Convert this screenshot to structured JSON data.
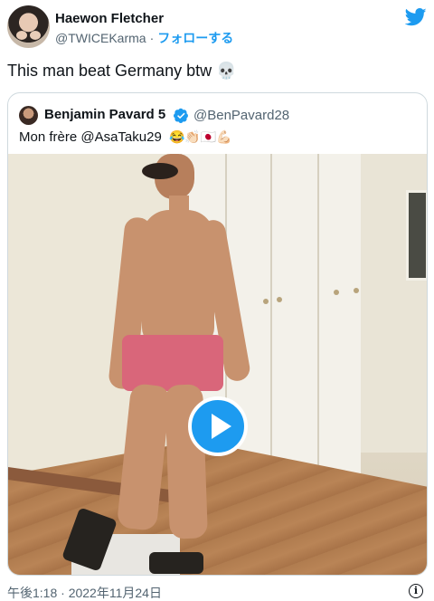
{
  "tweet": {
    "author_name": "Haewon Fletcher",
    "author_handle": "@TWICEKarma",
    "separator": "·",
    "follow_label": "フォローする",
    "text": "This man beat Germany btw",
    "text_emoji": "💀",
    "timestamp": "午後1:18 · 2022年11月24日",
    "info_icon_glyph": "i"
  },
  "quoted": {
    "author_name": "Benjamin Pavard 5",
    "author_handle": "@BenPavard28",
    "text": "Mon frère @AsaTaku29",
    "emojis": "😂👏🏻🇯🇵💪🏻",
    "media_type": "video"
  },
  "icons": {
    "brand": "twitter-bird-icon",
    "verified": "verified-badge-icon",
    "play": "play-icon",
    "info": "info-icon"
  },
  "colors": {
    "accent": "#1d9bf0",
    "text_primary": "#0f1419",
    "text_secondary": "#536471",
    "border": "#cfd9de"
  }
}
